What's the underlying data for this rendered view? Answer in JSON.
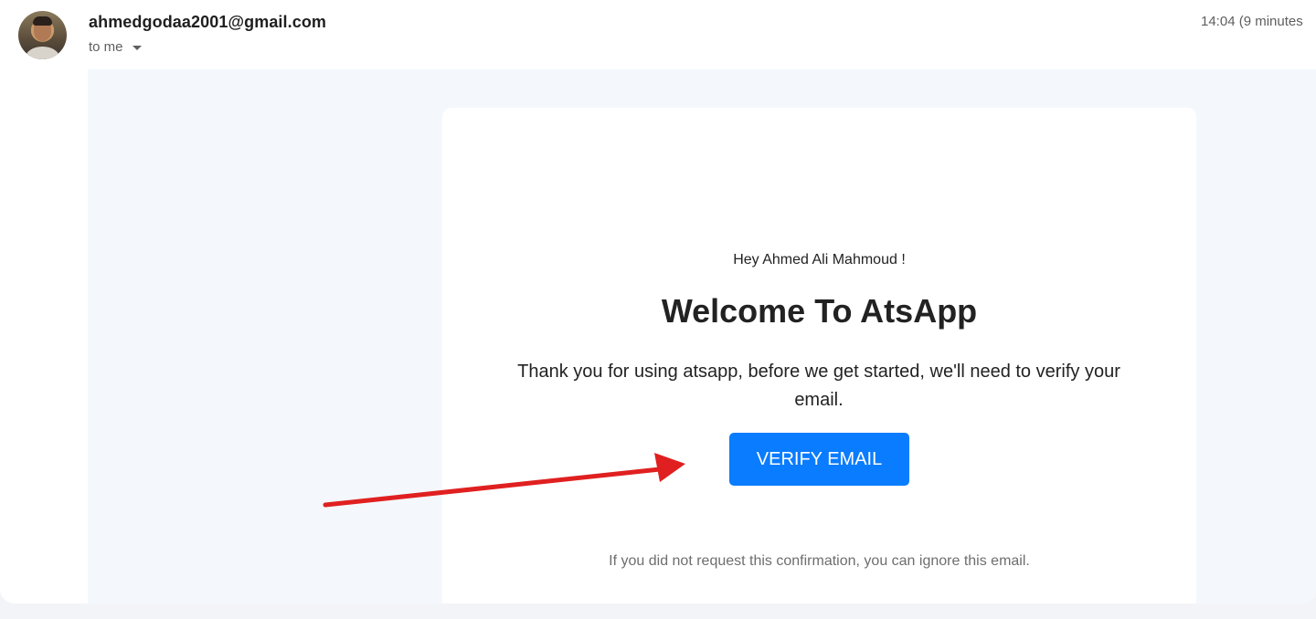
{
  "header": {
    "sender": "ahmedgodaa2001@gmail.com",
    "recipient_label": "to me",
    "timestamp": "14:04 (9 minutes"
  },
  "email": {
    "greeting": "Hey Ahmed Ali Mahmoud !",
    "title": "Welcome To AtsApp",
    "intro": "Thank you for using atsapp, before we get started, we'll need to verify your email.",
    "verify_button": "VERIFY EMAIL",
    "disclaimer": "If you did not request this confirmation, you can ignore this email."
  },
  "annotation": {
    "arrow_color": "#e02020",
    "arrow_target": "verify-button"
  },
  "colors": {
    "button": "#0a7cff",
    "body_background": "#f4f8fc"
  }
}
